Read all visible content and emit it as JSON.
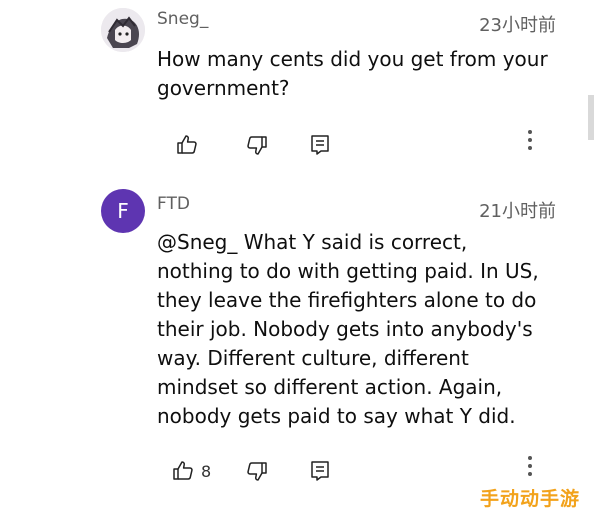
{
  "comments": [
    {
      "author": "Sneg_",
      "time": "23小时前",
      "text": "How many cents did you get from your\ngovernment?",
      "like_count": "",
      "avatar_icon": "anime-avatar-icon"
    },
    {
      "author": "FTD",
      "avatar_letter": "F",
      "time": "21小时前",
      "text": " @Sneg_  What Y said is correct,\nnothing to do with getting paid. In US,\nthey leave the firefighters alone to do\ntheir job. Nobody gets into anybody's\nway. Different culture, different\nmindset so different action. Again,\nnobody gets paid to say what Y did.",
      "like_count": "8"
    }
  ],
  "icons": {
    "like": "thumb-up-icon",
    "dislike": "thumb-down-icon",
    "reply": "reply-comment-icon",
    "more": "more-vertical-icon"
  },
  "colors": {
    "avatar_bg": "#5e35b1",
    "watermark": "#f2a21b"
  },
  "watermark": "手动动手游"
}
